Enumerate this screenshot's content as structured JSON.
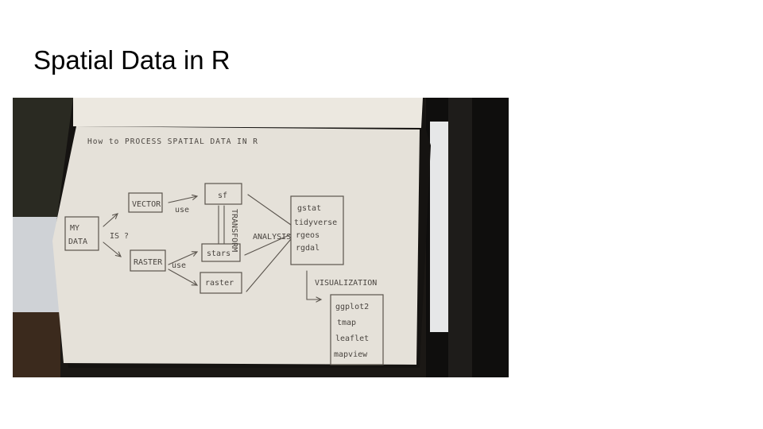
{
  "slide": {
    "title": "Spatial Data in R"
  },
  "sketch": {
    "heading": "How to PROCESS SPATIAL DATA IN R",
    "my_data": [
      "MY",
      "DATA"
    ],
    "is_label": "IS ?",
    "vector": "VECTOR",
    "raster_type": "RASTER",
    "use_top": "use",
    "use_bottom": "use",
    "sf": "sf",
    "stars": "stars",
    "raster_pkg": "raster",
    "transform": "TRANSFORM",
    "analysis": "ANALYSIS",
    "analysis_pkgs": [
      "gstat",
      "tidyverse",
      "rgeos",
      "rgdal"
    ],
    "visualization": "VISUALIZATION",
    "viz_pkgs": [
      "ggplot2",
      "tmap",
      "leaflet",
      "mapview"
    ]
  }
}
